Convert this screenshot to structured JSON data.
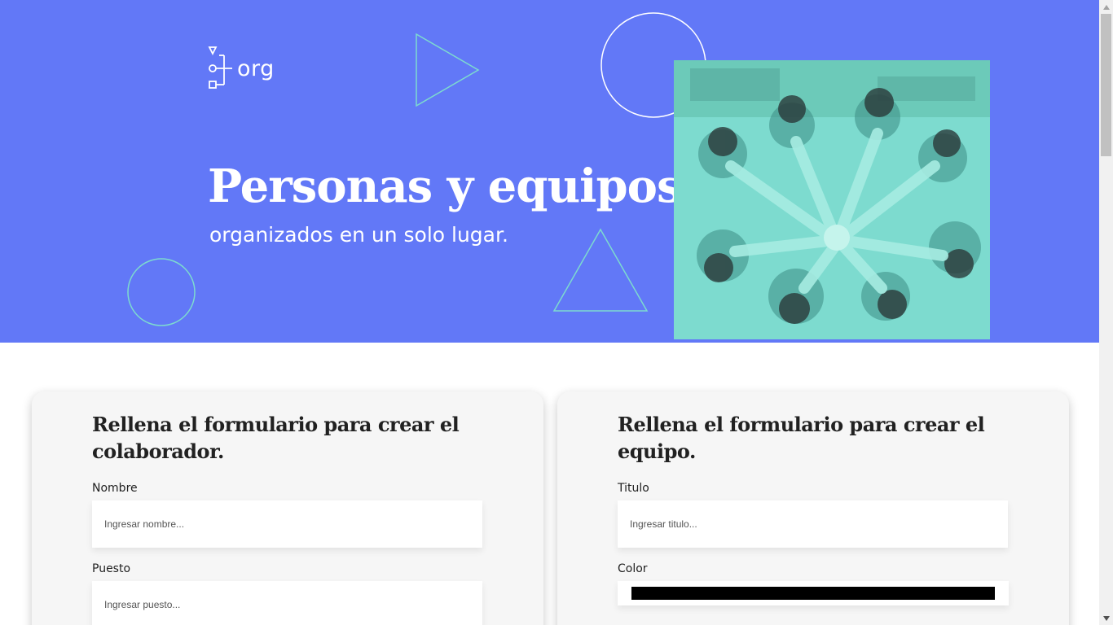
{
  "header": {
    "logo_text": "org",
    "title": "Personas y equipos",
    "subtitle": "organizados en un solo lugar.",
    "brand_color": "#6278f7",
    "accent_color": "#7ddbcf"
  },
  "collaborator_form": {
    "title": "Rellena el formulario para crear el colaborador.",
    "fields": [
      {
        "label": "Nombre",
        "placeholder": "Ingresar nombre...",
        "value": ""
      },
      {
        "label": "Puesto",
        "placeholder": "Ingresar puesto...",
        "value": ""
      }
    ]
  },
  "team_form": {
    "title": "Rellena el formulario para crear el equipo.",
    "fields": [
      {
        "label": "Titulo",
        "placeholder": "Ingresar titulo...",
        "value": ""
      },
      {
        "label": "Color",
        "value": "#000000"
      }
    ]
  }
}
